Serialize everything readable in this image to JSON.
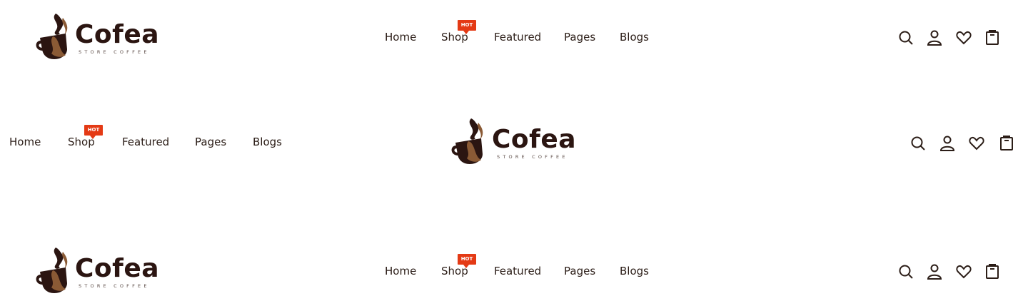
{
  "brand": {
    "name": "Cofea",
    "tagline": "STORE COFFEE"
  },
  "nav": {
    "items": [
      {
        "label": "Home"
      },
      {
        "label": "Shop",
        "badge": "HOT"
      },
      {
        "label": "Featured"
      },
      {
        "label": "Pages"
      },
      {
        "label": "Blogs"
      }
    ]
  },
  "actions": [
    "search-icon",
    "account-icon",
    "wishlist-icon",
    "cart-icon"
  ],
  "colors": {
    "text": "#2b1d17",
    "brand_dark": "#2b1511",
    "badge": "#e43a15",
    "background": "#ffffff"
  }
}
